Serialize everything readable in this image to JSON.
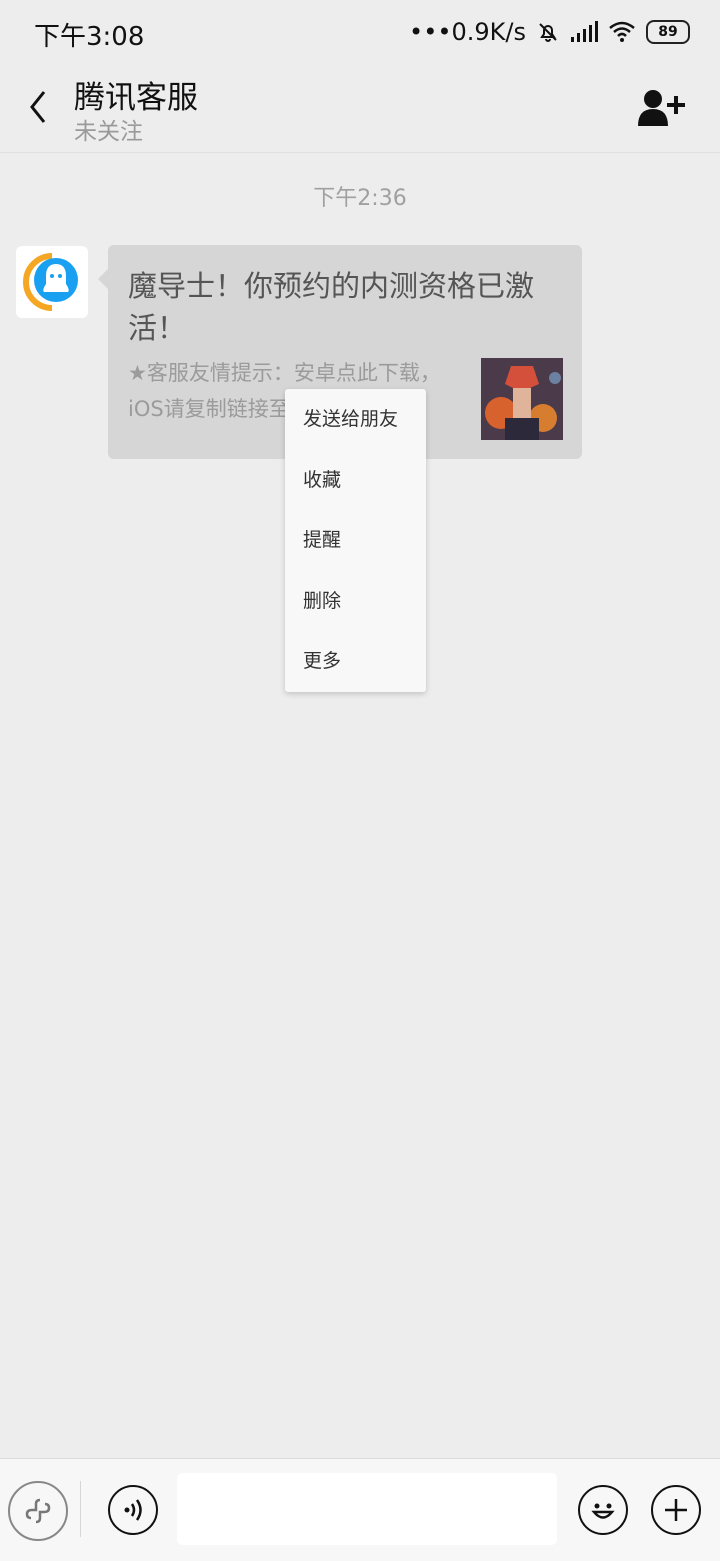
{
  "status_bar": {
    "time": "下午3:08",
    "network_speed": "•••0.9K/s",
    "battery": "89",
    "icons": [
      "bell-muted-icon",
      "signal-icon",
      "wifi-icon",
      "battery-icon"
    ]
  },
  "header": {
    "title": "腾讯客服",
    "subtitle": "未关注",
    "icons": [
      "back-arrow-icon",
      "add-user-icon"
    ]
  },
  "chat": {
    "time_separator": "下午2:36",
    "message": {
      "title": "魔导士！你预约的内测资格已激活！",
      "description": "★客服友情提示：安卓点此下载，iOS请复制链接至安卓下载★"
    }
  },
  "context_menu": {
    "items": [
      "发送给朋友",
      "收藏",
      "提醒",
      "删除",
      "更多"
    ]
  },
  "input_bar": {
    "value": "",
    "placeholder": "",
    "icons": [
      "mini-program-icon",
      "voice-icon",
      "emoji-icon",
      "plus-icon"
    ]
  },
  "colors": {
    "background": "#ededed",
    "bubble": "#d6d6d6",
    "menu": "#f8f8f8",
    "avatar_blue": "#1aa0f0",
    "avatar_orange": "#f5a623"
  }
}
